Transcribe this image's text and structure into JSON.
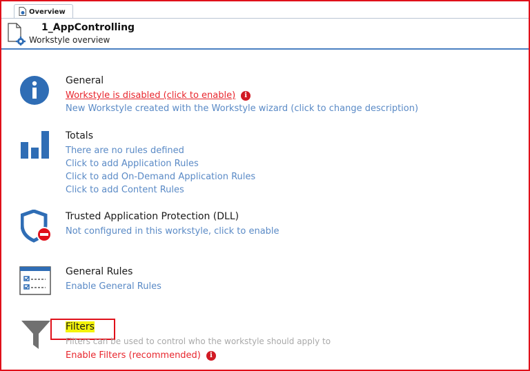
{
  "tab": {
    "label": "Overview"
  },
  "header": {
    "title": "1_AppControlling",
    "subtitle": "Workstyle overview"
  },
  "sections": {
    "general": {
      "title": "General",
      "status_link": "Workstyle is disabled (click to enable)",
      "description_link": "New Workstyle created with the Workstyle wizard (click to change description)"
    },
    "totals": {
      "title": "Totals",
      "links": [
        "There are no rules defined",
        "Click to add Application Rules",
        "Click to add On-Demand Application Rules",
        "Click to add Content Rules"
      ]
    },
    "tap": {
      "title": "Trusted Application Protection (DLL)",
      "link": "Not configured in this workstyle, click to enable"
    },
    "general_rules": {
      "title": "General Rules",
      "link": "Enable General Rules"
    },
    "filters": {
      "title": "Filters",
      "description": "Filters can be used to control who the workstyle should apply to",
      "link": "Enable Filters (recommended)"
    }
  },
  "colors": {
    "accent_blue": "#2f6db5",
    "link_blue": "#5a8ac6",
    "warning_red": "#e8262d",
    "highlight_yellow": "#f4f40a"
  },
  "icons": [
    "document-icon",
    "gear-icon",
    "info-icon",
    "bar-chart-icon",
    "shield-blocked-icon",
    "rules-list-icon",
    "funnel-icon",
    "warning-icon"
  ]
}
